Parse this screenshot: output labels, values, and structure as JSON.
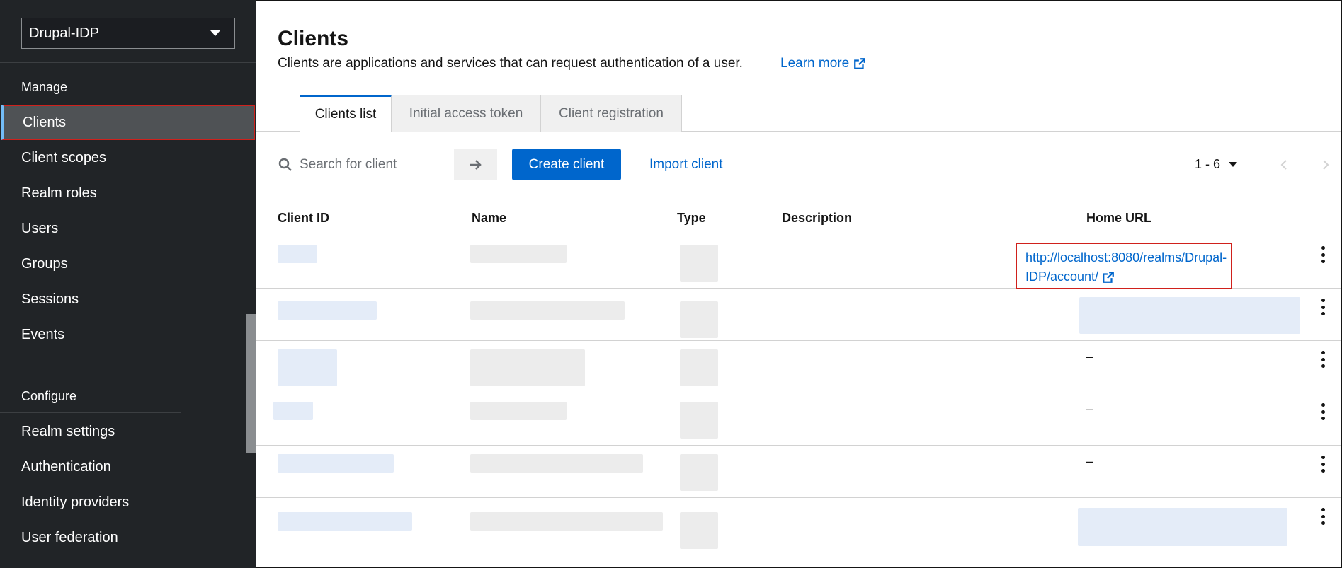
{
  "sidebar": {
    "realm": "Drupal-IDP",
    "manage_title": "Manage",
    "manage_items": [
      {
        "label": "Clients",
        "active": true
      },
      {
        "label": "Client scopes"
      },
      {
        "label": "Realm roles"
      },
      {
        "label": "Users"
      },
      {
        "label": "Groups"
      },
      {
        "label": "Sessions"
      },
      {
        "label": "Events"
      }
    ],
    "configure_title": "Configure",
    "configure_items": [
      {
        "label": "Realm settings"
      },
      {
        "label": "Authentication"
      },
      {
        "label": "Identity providers"
      },
      {
        "label": "User federation"
      }
    ]
  },
  "page": {
    "title": "Clients",
    "description": "Clients are applications and services that can request authentication of a user.",
    "learn_more": "Learn more"
  },
  "tabs": [
    {
      "label": "Clients list",
      "active": true
    },
    {
      "label": "Initial access token"
    },
    {
      "label": "Client registration"
    }
  ],
  "toolbar": {
    "search_placeholder": "Search for client",
    "create_label": "Create client",
    "import_label": "Import client",
    "pagination": "1 - 6"
  },
  "table": {
    "columns": [
      "Client ID",
      "Name",
      "Type",
      "Description",
      "Home URL"
    ],
    "rows": [
      {
        "home_url": "http://localhost:8080/realms/Drupal-IDP/account/"
      },
      {
        "home_url": ""
      },
      {
        "home_url": "–"
      },
      {
        "home_url": "–"
      },
      {
        "home_url": "–"
      },
      {
        "home_url": ""
      }
    ]
  },
  "colors": {
    "sidebar_bg": "#212427",
    "primary": "#0066cc",
    "highlight": "#d0211c"
  }
}
